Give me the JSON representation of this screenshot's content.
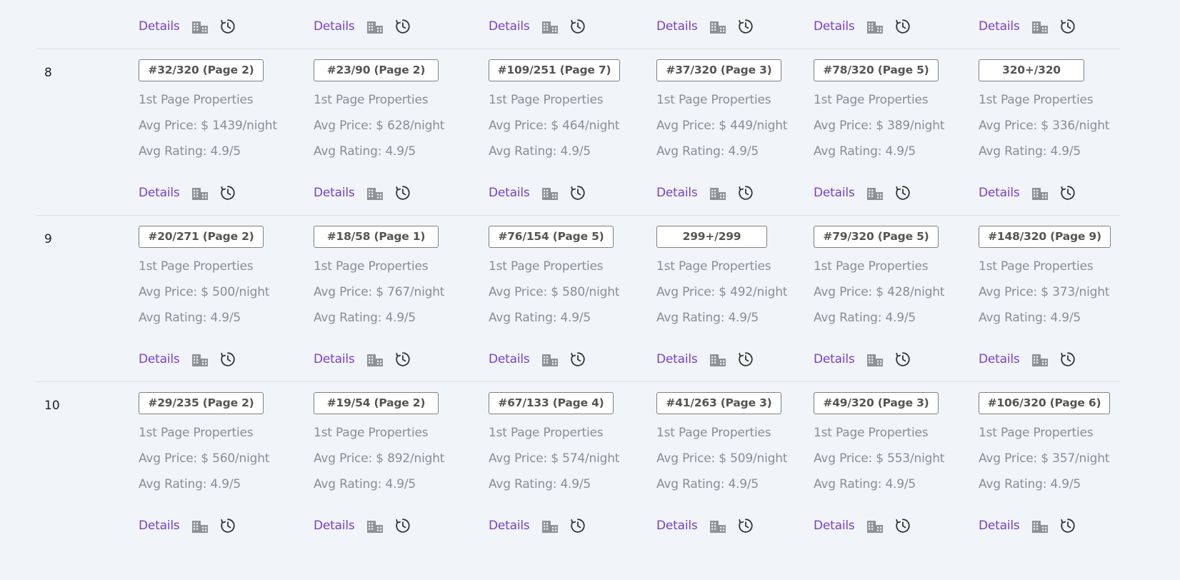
{
  "labels": {
    "details": "Details",
    "first_page": "1st Page Properties",
    "avg_price_prefix": "Avg Price: $ ",
    "avg_price_suffix": "/night",
    "avg_rating_prefix": "Avg Rating: ",
    "avg_rating_suffix": "/5"
  },
  "icons": {
    "building": "building-icon",
    "history": "history-icon"
  },
  "colors": {
    "link": "#7b3fc4",
    "icon": "#8f9196",
    "text_muted": "#8a8e94",
    "badge_border": "#7f7f7f"
  },
  "rows": [
    {
      "number": "8",
      "cells": [
        {
          "rank": "#32/320 (Page 2)",
          "price": "1439",
          "rating": "4.9"
        },
        {
          "rank": "#23/90 (Page 2)",
          "price": "628",
          "rating": "4.9"
        },
        {
          "rank": "#109/251 (Page 7)",
          "price": "464",
          "rating": "4.9"
        },
        {
          "rank": "#37/320 (Page 3)",
          "price": "449",
          "rating": "4.9"
        },
        {
          "rank": "#78/320 (Page 5)",
          "price": "389",
          "rating": "4.9"
        },
        {
          "rank": "320+/320",
          "price": "336",
          "rating": "4.9"
        }
      ]
    },
    {
      "number": "9",
      "cells": [
        {
          "rank": "#20/271 (Page 2)",
          "price": "500",
          "rating": "4.9"
        },
        {
          "rank": "#18/58 (Page 1)",
          "price": "767",
          "rating": "4.9"
        },
        {
          "rank": "#76/154 (Page 5)",
          "price": "580",
          "rating": "4.9"
        },
        {
          "rank": "299+/299",
          "price": "492",
          "rating": "4.9"
        },
        {
          "rank": "#79/320 (Page 5)",
          "price": "428",
          "rating": "4.9"
        },
        {
          "rank": "#148/320 (Page 9)",
          "price": "373",
          "rating": "4.9"
        }
      ]
    },
    {
      "number": "10",
      "cells": [
        {
          "rank": "#29/235 (Page 2)",
          "price": "560",
          "rating": "4.9"
        },
        {
          "rank": "#19/54 (Page 2)",
          "price": "892",
          "rating": "4.9"
        },
        {
          "rank": "#67/133 (Page 4)",
          "price": "574",
          "rating": "4.9"
        },
        {
          "rank": "#41/263 (Page 3)",
          "price": "509",
          "rating": "4.9"
        },
        {
          "rank": "#49/320 (Page 3)",
          "price": "553",
          "rating": "4.9"
        },
        {
          "rank": "#106/320 (Page 6)",
          "price": "357",
          "rating": "4.9"
        }
      ]
    }
  ]
}
